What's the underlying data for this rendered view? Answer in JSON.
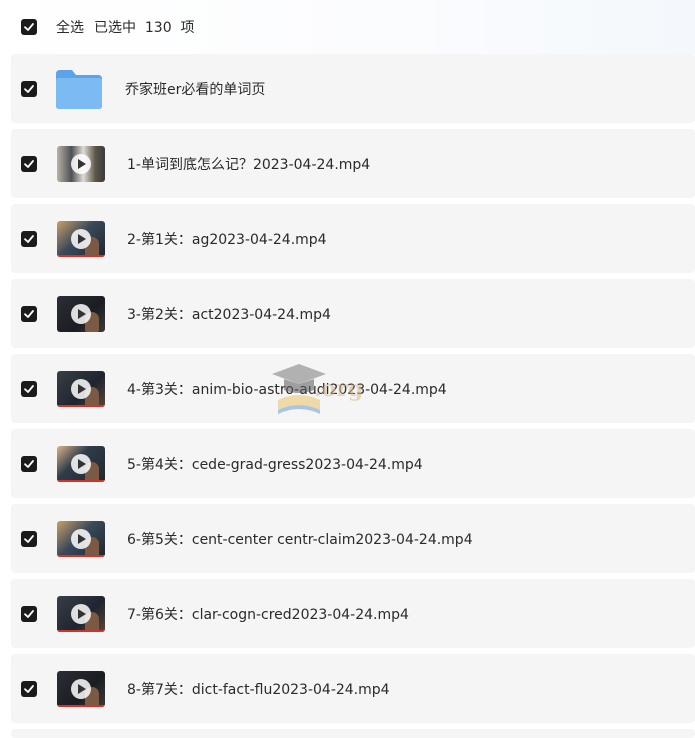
{
  "select_all": {
    "label": "全选",
    "count_text": "已选中  130  项",
    "checked": true
  },
  "rows": [
    {
      "name": "乔家班er必看的单词页",
      "kind": "folder",
      "checked": true,
      "icon": "folder-icon"
    },
    {
      "name": "1-单词到底怎么记？2023-04-24.mp4",
      "kind": "video",
      "checked": true,
      "icon": "video-thumbnail"
    },
    {
      "name": "2-第1关：ag2023-04-24.mp4",
      "kind": "video",
      "checked": true,
      "icon": "video-thumbnail"
    },
    {
      "name": "3-第2关：act2023-04-24.mp4",
      "kind": "video",
      "checked": true,
      "icon": "video-thumbnail"
    },
    {
      "name": "4-第3关：anim-bio-astro-audi2023-04-24.mp4",
      "kind": "video",
      "checked": true,
      "icon": "video-thumbnail"
    },
    {
      "name": "5-第4关：cede-grad-gress2023-04-24.mp4",
      "kind": "video",
      "checked": true,
      "icon": "video-thumbnail"
    },
    {
      "name": "6-第5关：cent-center centr-claim2023-04-24.mp4",
      "kind": "video",
      "checked": true,
      "icon": "video-thumbnail"
    },
    {
      "name": "7-第6关：clar-cogn-cred2023-04-24.mp4",
      "kind": "video",
      "checked": true,
      "icon": "video-thumbnail"
    },
    {
      "name": "8-第7关：dict-fact-flu2023-04-24.mp4",
      "kind": "video",
      "checked": true,
      "icon": "video-thumbnail"
    }
  ],
  "watermark": {
    "text": ".org",
    "icon": "graduation-cap-icon"
  },
  "colors": {
    "row_background": "#f5f5f5",
    "checkbox": "#1b1b1b",
    "text": "#2a2a2a",
    "folder": "#6aaef0",
    "thumbnail_accent": "#d3322b"
  }
}
